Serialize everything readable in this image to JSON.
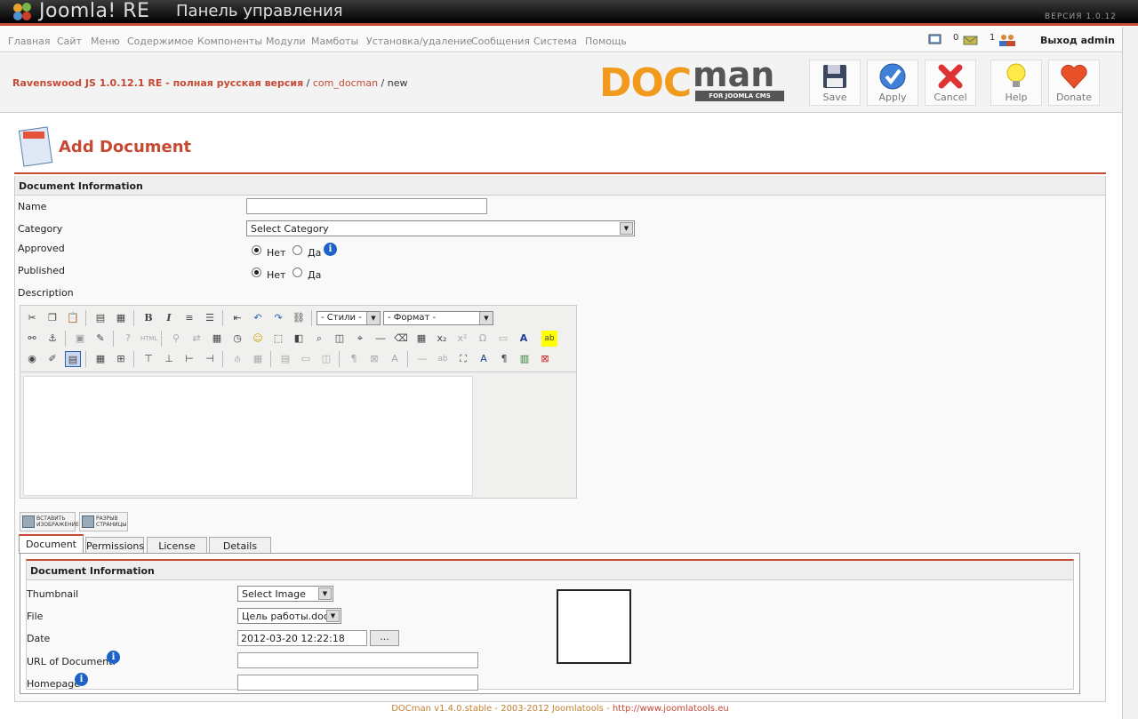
{
  "header": {
    "brand": "Joomla! RE",
    "title": "Панель управления",
    "version": "ВЕРСИЯ  1.0.12"
  },
  "menu": {
    "items": [
      "Главная",
      "Сайт",
      "Меню",
      "Содержимое",
      "Компоненты",
      "Модули",
      "Мамботы",
      "Установка/удаление",
      "Сообщения",
      "Система",
      "Помощь"
    ],
    "messages_count": "0",
    "users_count": "1",
    "logout": "Выход admin"
  },
  "breadcrumb": {
    "site": "Ravenswood JS 1.0.12.1 RE - полная русская версия",
    "sep1": " / ",
    "component": "com_docman",
    "sep2": " / ",
    "action": "new"
  },
  "docman_logo": {
    "word1": "DOC",
    "word2": "man",
    "tagline": "FOR JOOMLA CMS"
  },
  "toolbar": {
    "save": "Save",
    "apply": "Apply",
    "cancel": "Cancel",
    "help": "Help",
    "donate": "Donate"
  },
  "page": {
    "title": "Add Document"
  },
  "form": {
    "section": "Document Information",
    "name_label": "Name",
    "name_value": "",
    "category_label": "Category",
    "category_value": "Select Category",
    "approved_label": "Approved",
    "published_label": "Published",
    "radio_no": "Нет",
    "radio_yes": "Да",
    "approved_value": "Нет",
    "published_value": "Нет",
    "description_label": "Description"
  },
  "editor": {
    "styles": "- Стили -",
    "format": "- Формат -",
    "insert_image": [
      "ВСТАВИТЬ",
      "ИЗОБРАЖЕНИЕ"
    ],
    "page_break": [
      "РАЗРЫВ",
      "СТРАНИЦЫ"
    ]
  },
  "tabs": [
    "Document",
    "Permissions",
    "License",
    "Details"
  ],
  "active_tab": "Document",
  "doc_info": {
    "section": "Document Information",
    "thumbnail_label": "Thumbnail",
    "thumbnail_value": "Select Image",
    "file_label": "File",
    "file_value": "Цель работы.doc",
    "date_label": "Date",
    "date_value": "2012-03-20 12:22:18",
    "date_button": "...",
    "url_label": "URL of Document:",
    "url_value": "",
    "homepage_label": "Homepage",
    "homepage_value": ""
  },
  "footer": {
    "text": "DOCman v1.4.0.stable - 2003-2012 Joomlatools - ",
    "link": "http://www.joomlatools.eu"
  },
  "colors": {
    "accent": "#c64934",
    "topbar": "#000000",
    "docman_orange": "#f29a1d"
  }
}
